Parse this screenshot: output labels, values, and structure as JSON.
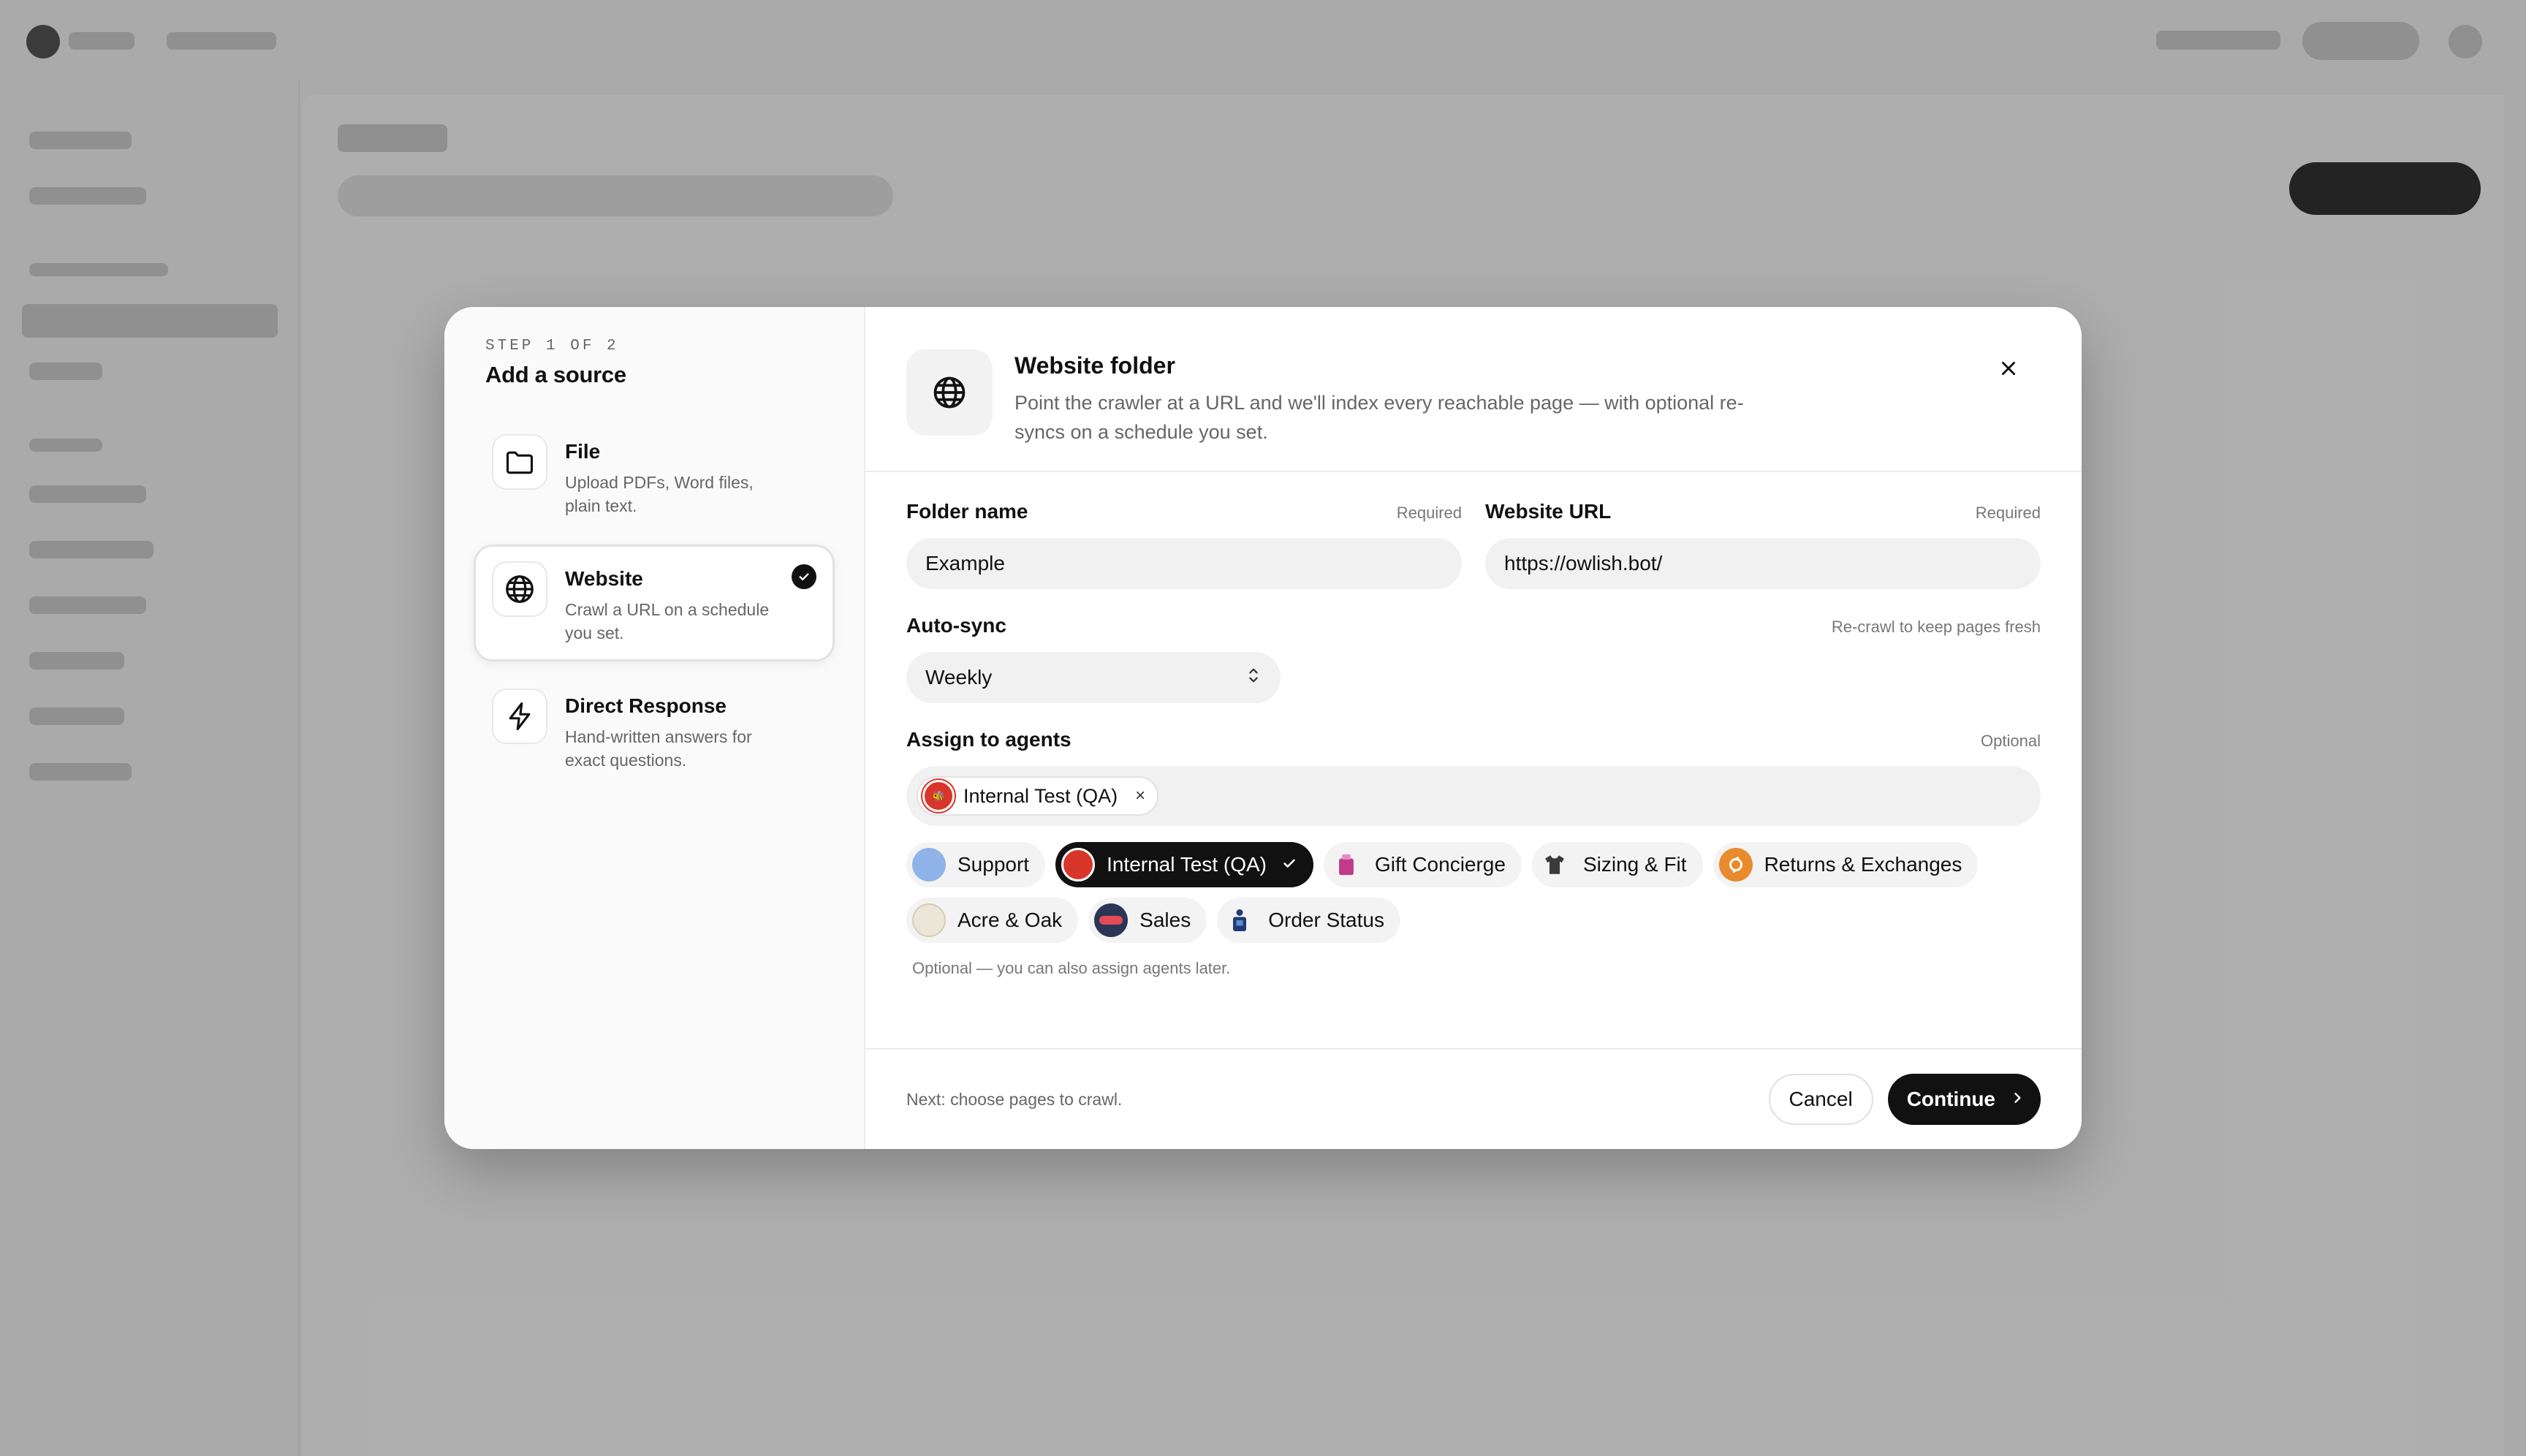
{
  "modal": {
    "step": "STEP 1 OF 2",
    "title": "Add a source",
    "options": [
      {
        "label": "File",
        "desc": "Upload PDFs, Word files, plain text.",
        "icon": "folder-icon",
        "selected": false
      },
      {
        "label": "Website",
        "desc": "Crawl a URL on a schedule you set.",
        "icon": "globe-icon",
        "selected": true
      },
      {
        "label": "Direct Response",
        "desc": "Hand-written answers for exact questions.",
        "icon": "lightning-icon",
        "selected": false
      }
    ],
    "header": {
      "title": "Website folder",
      "desc": "Point the crawler at a URL and we'll index every reachable page — with optional re-syncs on a schedule you set.",
      "icon": "globe-icon"
    },
    "form": {
      "folder_name": {
        "label": "Folder name",
        "hint": "Required",
        "value": "Example"
      },
      "website_url": {
        "label": "Website URL",
        "hint": "Required",
        "value": "https://owlish.bot/"
      },
      "auto_sync": {
        "label": "Auto-sync",
        "hint": "Re-crawl to keep pages fresh",
        "value": "Weekly"
      },
      "agents": {
        "label": "Assign to agents",
        "hint": "Optional",
        "selected_tags": [
          {
            "name": "Internal Test (QA)",
            "remove": "×"
          }
        ],
        "options": [
          {
            "name": "Support",
            "selected": false,
            "color": "#8fb3e8"
          },
          {
            "name": "Internal Test (QA)",
            "selected": true,
            "color": "#d9362b"
          },
          {
            "name": "Gift Concierge",
            "selected": false,
            "color": "#c23a8a"
          },
          {
            "name": "Sizing & Fit",
            "selected": false,
            "color": "#3a3a3a"
          },
          {
            "name": "Returns & Exchanges",
            "selected": false,
            "color": "#e98a2d"
          },
          {
            "name": "Acre & Oak",
            "selected": false,
            "color": "#d8cdb5"
          },
          {
            "name": "Sales",
            "selected": false,
            "color": "#2b3556"
          },
          {
            "name": "Order Status",
            "selected": false,
            "color": "#1f3b73"
          }
        ],
        "note": "Optional — you can also assign agents later."
      }
    },
    "footer": {
      "note": "Next: choose pages to crawl.",
      "cancel": "Cancel",
      "continue": "Continue"
    }
  }
}
